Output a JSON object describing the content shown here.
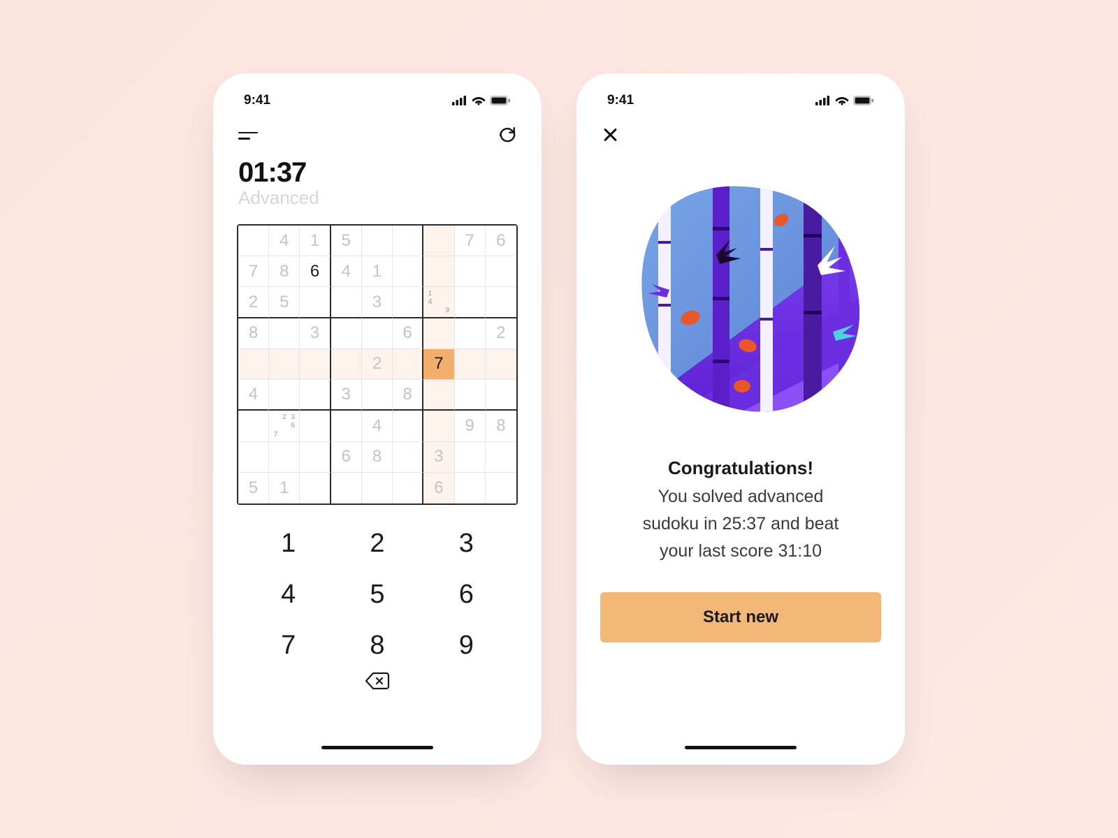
{
  "status": {
    "time": "9:41"
  },
  "game": {
    "timer": "01:37",
    "difficulty": "Advanced",
    "selected": {
      "row": 4,
      "col": 6
    },
    "grid": [
      [
        null,
        4,
        1,
        5,
        null,
        null,
        null,
        7,
        6
      ],
      [
        7,
        8,
        6,
        4,
        1,
        null,
        null,
        null,
        null
      ],
      [
        2,
        5,
        null,
        null,
        3,
        null,
        null,
        null,
        null
      ],
      [
        8,
        null,
        3,
        null,
        null,
        6,
        null,
        null,
        2
      ],
      [
        null,
        null,
        null,
        null,
        2,
        null,
        7,
        null,
        null
      ],
      [
        4,
        null,
        null,
        3,
        null,
        8,
        null,
        null,
        null
      ],
      [
        null,
        null,
        null,
        null,
        4,
        null,
        null,
        9,
        8
      ],
      [
        null,
        null,
        null,
        6,
        8,
        null,
        3,
        null,
        null
      ],
      [
        5,
        1,
        null,
        null,
        null,
        null,
        6,
        null,
        null
      ]
    ],
    "user_cells": [
      [
        1,
        2
      ]
    ],
    "notes": {
      "2,6": {
        "1": true,
        "4": true,
        "9": true
      },
      "6,1": {
        "2": true,
        "3": true,
        "6": true,
        "7": true
      }
    },
    "keypad": [
      "1",
      "2",
      "3",
      "4",
      "5",
      "6",
      "7",
      "8",
      "9"
    ]
  },
  "result": {
    "title": "Congratulations!",
    "body_line1": "You solved advanced",
    "body_line2": "sudoku in 25:37 and beat",
    "body_line3": "your last score 31:10",
    "cta": "Start new"
  }
}
